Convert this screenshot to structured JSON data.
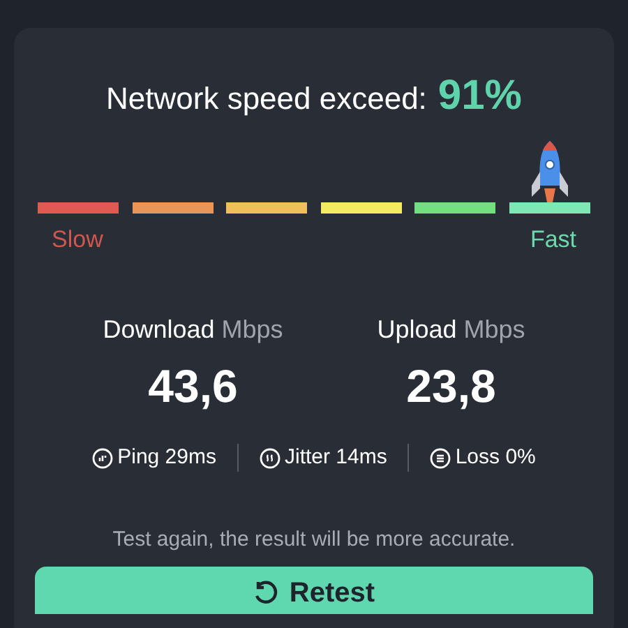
{
  "headline": {
    "label": "Network speed exceed:",
    "percent": "91%"
  },
  "meter": {
    "segments": [
      {
        "color": "#e05a52"
      },
      {
        "color": "#e8955a"
      },
      {
        "color": "#efbf5a"
      },
      {
        "color": "#f3ec63"
      },
      {
        "color": "#72e07e"
      },
      {
        "color": "#7ee8b5"
      }
    ],
    "low_label": "Slow",
    "high_label": "Fast"
  },
  "speeds": [
    {
      "label": "Download",
      "unit": "Mbps",
      "value": "43,6"
    },
    {
      "label": "Upload",
      "unit": "Mbps",
      "value": "23,8"
    }
  ],
  "stats": [
    {
      "kind": "ping",
      "text": "Ping 29ms"
    },
    {
      "kind": "jitter",
      "text": "Jitter 14ms"
    },
    {
      "kind": "loss",
      "text": "Loss 0%"
    }
  ],
  "note": "Test again, the result will be more accurate.",
  "button": {
    "label": "Retest"
  }
}
